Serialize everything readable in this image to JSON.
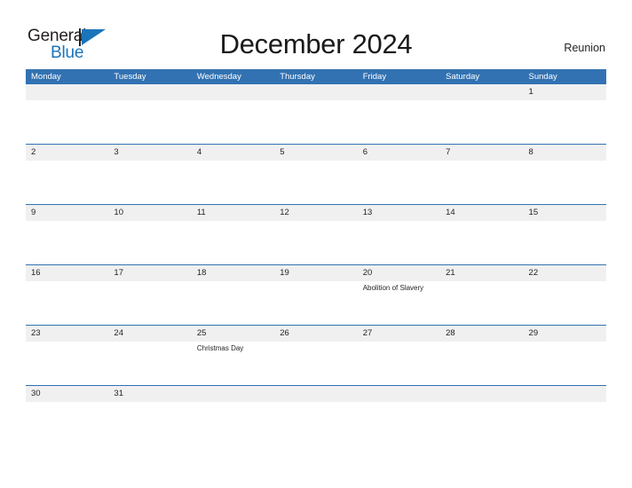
{
  "brand": {
    "line1": "General",
    "line2": "Blue",
    "flag_icon": "blue-flag-triangle-icon",
    "color_dark": "#231f20",
    "color_blue": "#1b75bb"
  },
  "header": {
    "title": "December 2024",
    "region": "Reunion"
  },
  "theme": {
    "header_blue": "#3272b2",
    "row_gray": "#f0f0f0",
    "text": "#231f20",
    "white": "#ffffff"
  },
  "calendar": {
    "weekdays": [
      "Monday",
      "Tuesday",
      "Wednesday",
      "Thursday",
      "Friday",
      "Saturday",
      "Sunday"
    ],
    "weeks": [
      {
        "days": [
          {
            "date": "",
            "event": ""
          },
          {
            "date": "",
            "event": ""
          },
          {
            "date": "",
            "event": ""
          },
          {
            "date": "",
            "event": ""
          },
          {
            "date": "",
            "event": ""
          },
          {
            "date": "",
            "event": ""
          },
          {
            "date": "1",
            "event": ""
          }
        ]
      },
      {
        "days": [
          {
            "date": "2",
            "event": ""
          },
          {
            "date": "3",
            "event": ""
          },
          {
            "date": "4",
            "event": ""
          },
          {
            "date": "5",
            "event": ""
          },
          {
            "date": "6",
            "event": ""
          },
          {
            "date": "7",
            "event": ""
          },
          {
            "date": "8",
            "event": ""
          }
        ]
      },
      {
        "days": [
          {
            "date": "9",
            "event": ""
          },
          {
            "date": "10",
            "event": ""
          },
          {
            "date": "11",
            "event": ""
          },
          {
            "date": "12",
            "event": ""
          },
          {
            "date": "13",
            "event": ""
          },
          {
            "date": "14",
            "event": ""
          },
          {
            "date": "15",
            "event": ""
          }
        ]
      },
      {
        "days": [
          {
            "date": "16",
            "event": ""
          },
          {
            "date": "17",
            "event": ""
          },
          {
            "date": "18",
            "event": ""
          },
          {
            "date": "19",
            "event": ""
          },
          {
            "date": "20",
            "event": "Abolition of Slavery"
          },
          {
            "date": "21",
            "event": ""
          },
          {
            "date": "22",
            "event": ""
          }
        ]
      },
      {
        "days": [
          {
            "date": "23",
            "event": ""
          },
          {
            "date": "24",
            "event": ""
          },
          {
            "date": "25",
            "event": "Christmas Day"
          },
          {
            "date": "26",
            "event": ""
          },
          {
            "date": "27",
            "event": ""
          },
          {
            "date": "28",
            "event": ""
          },
          {
            "date": "29",
            "event": ""
          }
        ]
      },
      {
        "days": [
          {
            "date": "30",
            "event": ""
          },
          {
            "date": "31",
            "event": ""
          },
          {
            "date": "",
            "event": ""
          },
          {
            "date": "",
            "event": ""
          },
          {
            "date": "",
            "event": ""
          },
          {
            "date": "",
            "event": ""
          },
          {
            "date": "",
            "event": ""
          }
        ]
      }
    ]
  }
}
